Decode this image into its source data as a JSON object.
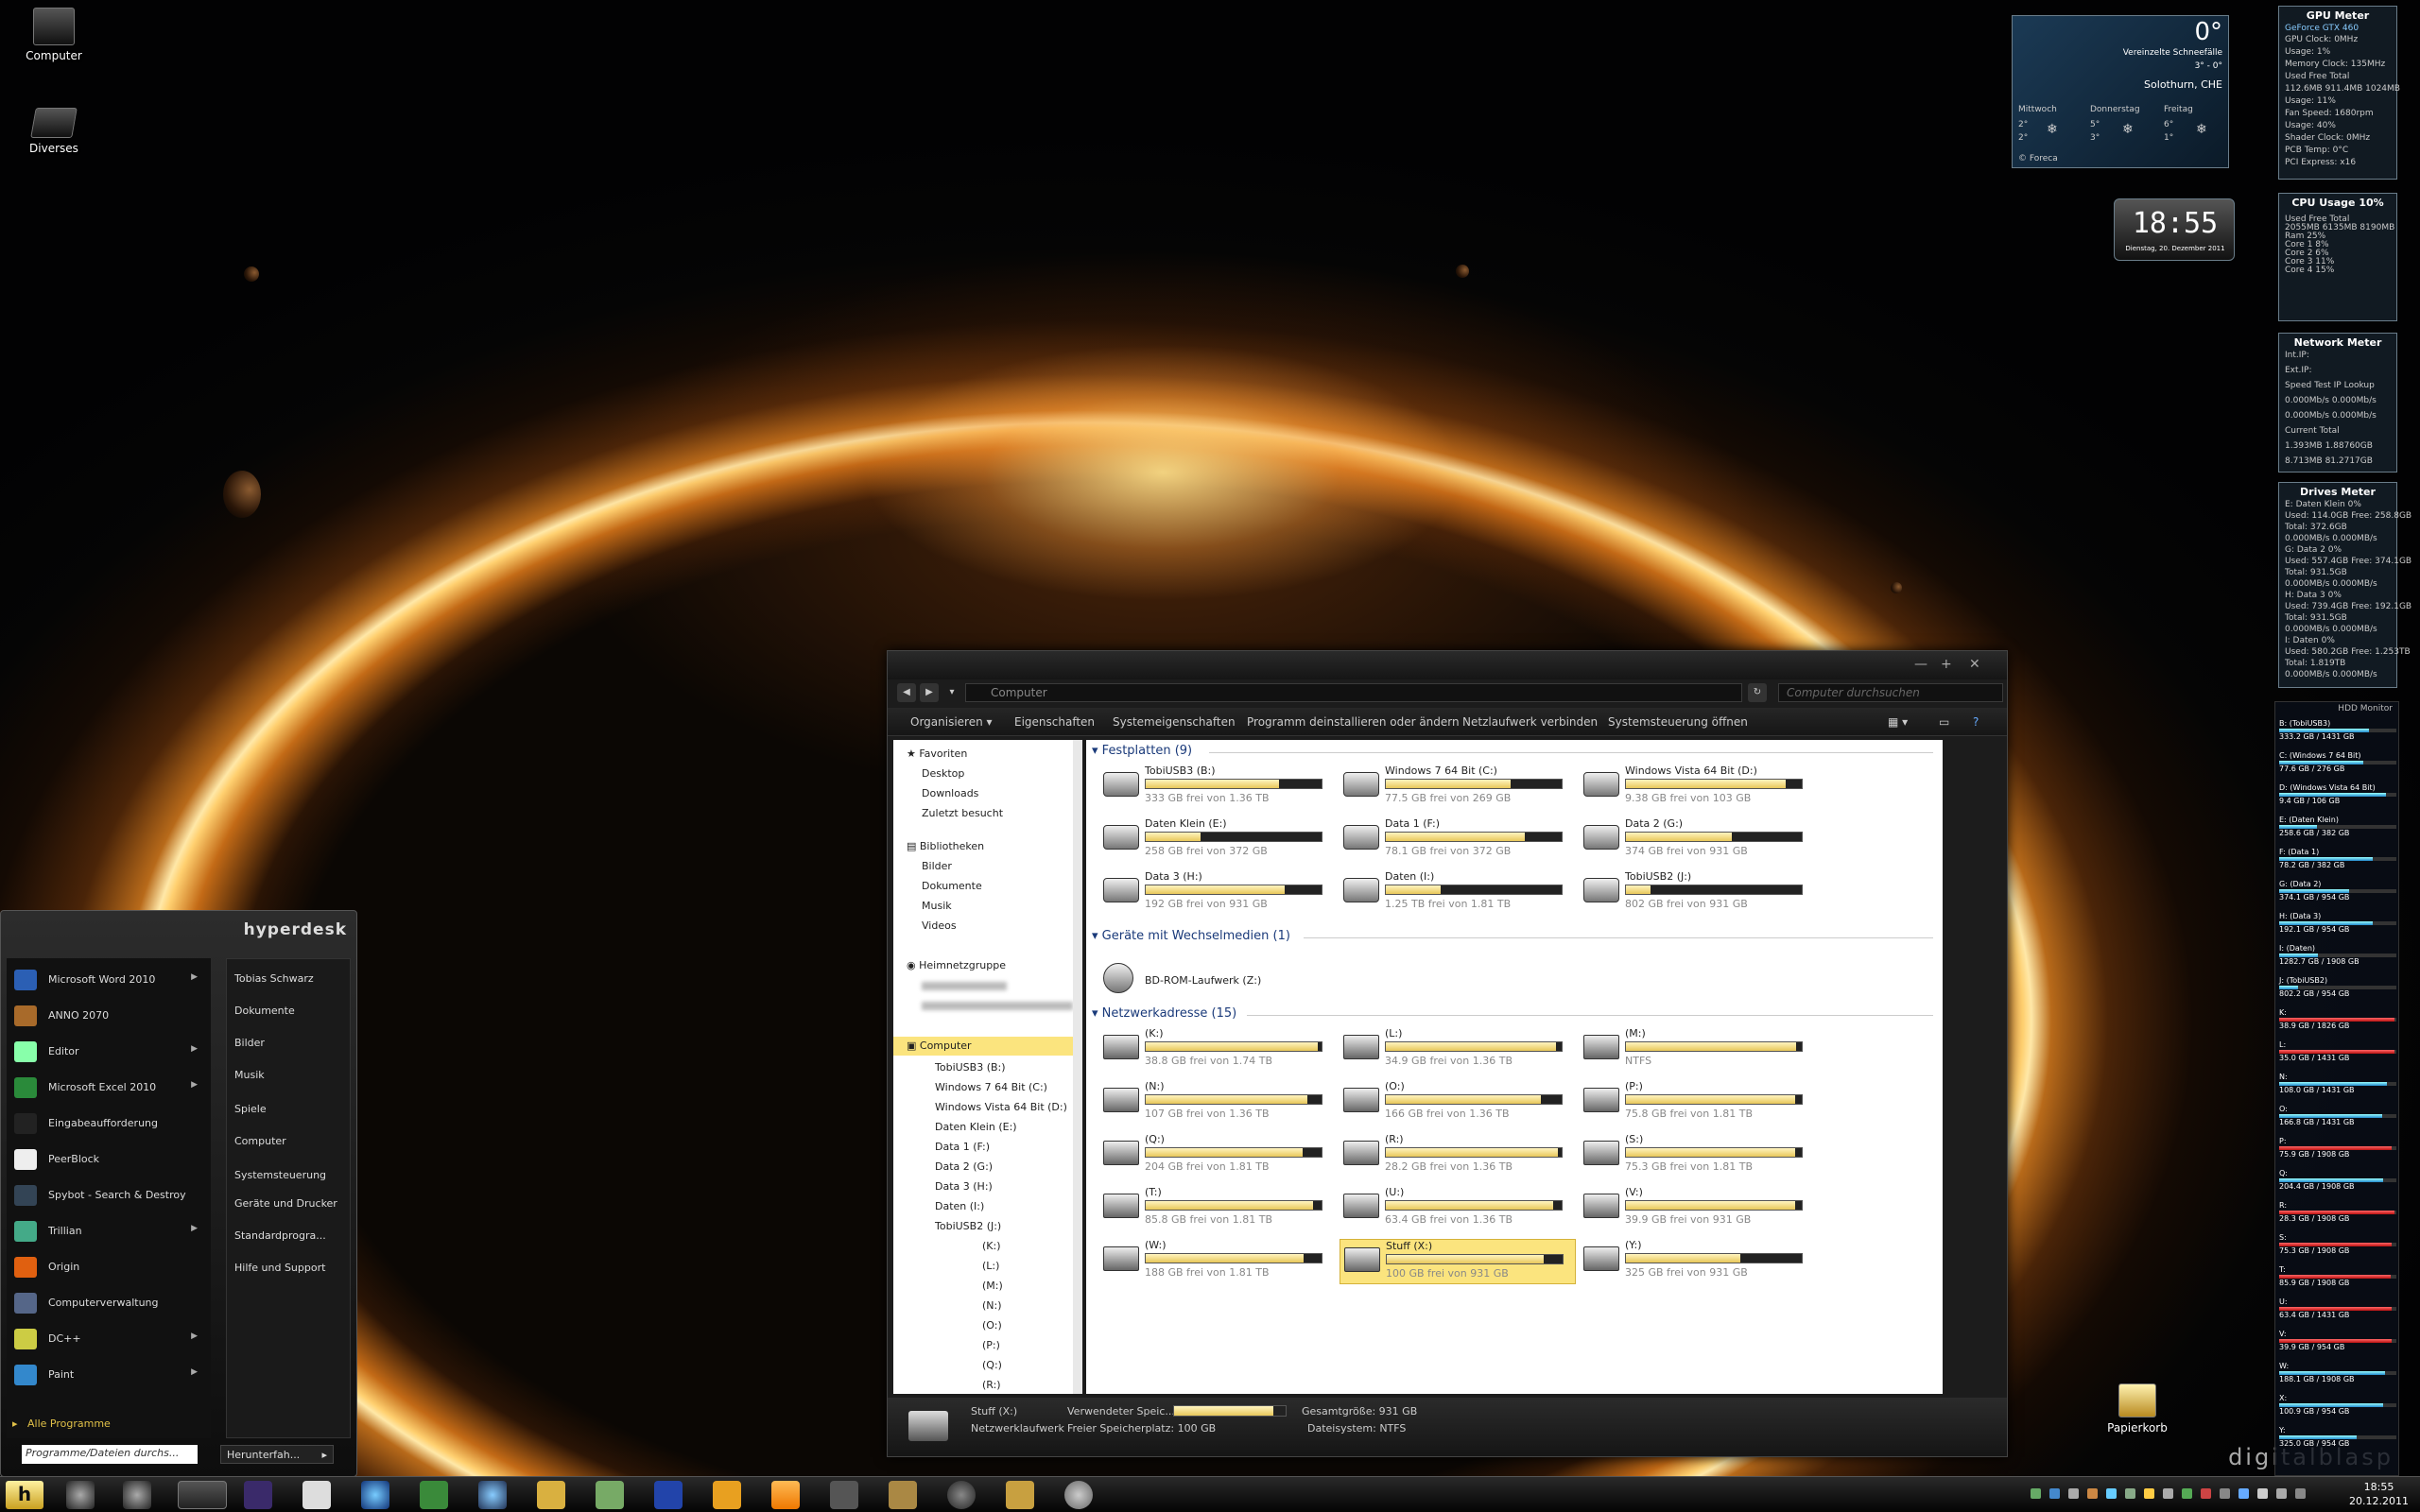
{
  "desktop": {
    "icons": [
      {
        "label": "Computer"
      },
      {
        "label": "Diverses"
      }
    ],
    "recycle_bin": "Papierkorb",
    "watermark": "digitalblasp"
  },
  "explorer": {
    "address": "Computer",
    "search_placeholder": "Computer durchsuchen",
    "toolbar": [
      "Organisieren ▾",
      "Eigenschaften",
      "Systemeigenschaften",
      "Programm deinstallieren oder ändern",
      "Netzlaufwerk verbinden",
      "Systemsteuerung öffnen"
    ],
    "sidebar": {
      "favorites": "Favoriten",
      "favorite_items": [
        "Desktop",
        "Downloads",
        "Zuletzt besucht"
      ],
      "libraries": "Bibliotheken",
      "library_items": [
        "Bilder",
        "Dokumente",
        "Musik",
        "Videos"
      ],
      "homegroup": "Heimnetzgruppe",
      "computer": "Computer",
      "computer_items": [
        "TobiUSB3 (B:)",
        "Windows 7 64 Bit (C:)",
        "Windows Vista 64 Bit (D:)",
        "Daten Klein (E:)",
        "Data 1 (F:)",
        "Data 2 (G:)",
        "Data 3 (H:)",
        "Daten (I:)",
        "TobiUSB2 (J:)"
      ],
      "network_items": [
        "(K:)",
        "(L:)",
        "(M:)",
        "(N:)",
        "(O:)",
        "(P:)",
        "(Q:)",
        "(R:)"
      ]
    },
    "groups": {
      "hard_disks": "Festplatten (9)",
      "removable": "Geräte mit Wechselmedien (1)",
      "network": "Netzwerkadresse (15)"
    },
    "hard_disks": [
      {
        "name": "TobiUSB3 (B:)",
        "free": "333 GB frei von 1.36 TB",
        "used": 0.76
      },
      {
        "name": "Windows 7 64 Bit (C:)",
        "free": "77.5 GB frei von 269 GB",
        "used": 0.71
      },
      {
        "name": "Windows Vista 64 Bit (D:)",
        "free": "9.38 GB frei von 103 GB",
        "used": 0.91
      },
      {
        "name": "Daten Klein (E:)",
        "free": "258 GB frei von 372 GB",
        "used": 0.31
      },
      {
        "name": "Data 1 (F:)",
        "free": "78.1 GB frei von 372 GB",
        "used": 0.79
      },
      {
        "name": "Data 2 (G:)",
        "free": "374 GB frei von 931 GB",
        "used": 0.6
      },
      {
        "name": "Data 3 (H:)",
        "free": "192 GB frei von 931 GB",
        "used": 0.79
      },
      {
        "name": "Daten (I:)",
        "free": "1.25 TB frei von 1.81 TB",
        "used": 0.31
      },
      {
        "name": "TobiUSB2 (J:)",
        "free": "802 GB frei von 931 GB",
        "used": 0.14
      }
    ],
    "removable": [
      {
        "name": "BD-ROM-Laufwerk (Z:)"
      }
    ],
    "network": [
      {
        "name": "(K:)",
        "free": "38.8 GB frei von 1.74 TB",
        "used": 0.98
      },
      {
        "name": "(L:)",
        "free": "34.9 GB frei von 1.36 TB",
        "used": 0.97
      },
      {
        "name": "(M:)",
        "free": "NTFS",
        "used": 0.97
      },
      {
        "name": "(N:)",
        "free": "107 GB frei von 1.36 TB",
        "used": 0.92
      },
      {
        "name": "(O:)",
        "free": "166 GB frei von 1.36 TB",
        "used": 0.88
      },
      {
        "name": "(P:)",
        "free": "75.8 GB frei von 1.81 TB",
        "used": 0.96
      },
      {
        "name": "(Q:)",
        "free": "204 GB frei von 1.81 TB",
        "used": 0.89
      },
      {
        "name": "(R:)",
        "free": "28.2 GB frei von 1.36 TB",
        "used": 0.98
      },
      {
        "name": "(S:)",
        "free": "75.3 GB frei von 1.81 TB",
        "used": 0.96
      },
      {
        "name": "(T:)",
        "free": "85.8 GB frei von 1.81 TB",
        "used": 0.95
      },
      {
        "name": "(U:)",
        "free": "63.4 GB frei von 1.36 TB",
        "used": 0.95
      },
      {
        "name": "(V:)",
        "free": "39.9 GB frei von 931 GB",
        "used": 0.96
      },
      {
        "name": "(W:)",
        "free": "188 GB frei von 1.81 TB",
        "used": 0.9
      },
      {
        "name": "Stuff (X:)",
        "free": "100 GB frei von 931 GB",
        "used": 0.89
      },
      {
        "name": "(Y:)",
        "free": "325 GB frei von 931 GB",
        "used": 0.65
      }
    ],
    "details": {
      "name": "Stuff (X:)",
      "type": "Netzwerklaufwerk",
      "used_label": "Verwendeter Speic...",
      "total_label": "Gesamtgröße: 931 GB",
      "free_label": "Freier Speicherplatz: 100 GB",
      "fs_label": "Dateisystem: NTFS",
      "used": 0.89
    }
  },
  "start_menu": {
    "brand": "hyperdesk",
    "programs": [
      {
        "label": "Microsoft Word 2010",
        "arrow": "▶"
      },
      {
        "label": "ANNO 2070",
        "arrow": ""
      },
      {
        "label": "Editor",
        "arrow": "▶"
      },
      {
        "label": "Microsoft Excel 2010",
        "arrow": "▶"
      },
      {
        "label": "Eingabeaufforderung",
        "arrow": ""
      },
      {
        "label": "PeerBlock",
        "arrow": ""
      },
      {
        "label": "Spybot - Search & Destroy",
        "arrow": ""
      },
      {
        "label": "Trillian",
        "arrow": "▶"
      },
      {
        "label": "Origin",
        "arrow": ""
      },
      {
        "label": "Computerverwaltung",
        "arrow": ""
      },
      {
        "label": "DC++",
        "arrow": "▶"
      },
      {
        "label": "Paint",
        "arrow": "▶"
      }
    ],
    "all_programs": "Alle Programme",
    "right": [
      "Tobias Schwarz",
      "Dokumente",
      "Bilder",
      "Musik",
      "Spiele",
      "Computer",
      "Systemsteuerung",
      "Geräte und Drucker",
      "Standardprogra...",
      "Hilfe und Support"
    ],
    "search_placeholder": "Programme/Dateien durchs...",
    "shutdown": "Herunterfah..."
  },
  "taskbar": {
    "start": "h",
    "time": "18:55",
    "date": "20.12.2011"
  },
  "gadgets": {
    "weather": {
      "temp": "0°",
      "condition": "Vereinzelte Schneefälle",
      "range": "3° - 0°",
      "location": "Solothurn, CHE",
      "days": [
        {
          "day": "Mittwoch",
          "hi": "2°",
          "lo": "2°"
        },
        {
          "day": "Donnerstag",
          "hi": "5°",
          "lo": "3°"
        },
        {
          "day": "Freitag",
          "hi": "6°",
          "lo": "1°"
        }
      ],
      "source": "© Foreca"
    },
    "clock": {
      "time": "18:55",
      "date": "Dienstag, 20. Dezember 2011"
    },
    "gpu": {
      "title": "GPU Meter",
      "model": "GeForce GTX 460",
      "lines": [
        "GPU Clock: 0MHz",
        "Usage: 1%",
        "Memory Clock: 135MHz",
        "Used Free Total",
        "112.6MB 911.4MB 1024MB",
        "Usage: 11%",
        "Fan Speed: 1680rpm",
        "Usage: 40%",
        "Shader Clock: 0MHz",
        "PCB Temp: 0°C",
        "PCI Express: x16"
      ]
    },
    "cpu": {
      "title": "CPU Usage",
      "value": "10%",
      "lines": [
        "Used Free Total",
        "2055MB 6135MB 8190MB",
        "Ram 25%",
        "Core 1 8%",
        "Core 2 6%",
        "Core 3 11%",
        "Core 4 15%"
      ]
    },
    "network": {
      "title": "Network Meter",
      "lines": [
        "Int.IP:",
        "Ext.IP:",
        "Speed Test   IP Lookup",
        "0.000Mb/s  0.000Mb/s",
        "0.000Mb/s  0.000Mb/s",
        "Current        Total",
        "1.393MB     1.88760GB",
        "8.713MB     81.2717GB"
      ]
    },
    "drives": {
      "title": "Drives Meter",
      "lines": [
        "E: Daten Klein 0%",
        "Used: 114.0GB Free: 258.8GB",
        "Total: 372.6GB",
        "0.000MB/s 0.000MB/s",
        "G: Data 2 0%",
        "Used: 557.4GB Free: 374.1GB",
        "Total: 931.5GB",
        "0.000MB/s 0.000MB/s",
        "H: Data 3 0%",
        "Used: 739.4GB Free: 192.1GB",
        "Total: 931.5GB",
        "0.000MB/s 0.000MB/s",
        "I: Daten 0%",
        "Used: 580.2GB Free: 1.253TB",
        "Total: 1.819TB",
        "0.000MB/s 0.000MB/s"
      ]
    },
    "hdd": {
      "title": "HDD Monitor",
      "rows": [
        {
          "n": "B: (TobiUSB3)",
          "s": "333.2 GB / 1431 GB",
          "f": 0.77
        },
        {
          "n": "C: (Windows 7 64 Bit)",
          "s": "77.6 GB / 276 GB",
          "f": 0.72
        },
        {
          "n": "D: (Windows Vista 64 Bit)",
          "s": "9.4 GB / 106 GB",
          "f": 0.91
        },
        {
          "n": "E: (Daten Klein)",
          "s": "258.6 GB / 382 GB",
          "f": 0.32
        },
        {
          "n": "F: (Data 1)",
          "s": "78.2 GB / 382 GB",
          "f": 0.8
        },
        {
          "n": "G: (Data 2)",
          "s": "374.1 GB / 954 GB",
          "f": 0.6
        },
        {
          "n": "H: (Data 3)",
          "s": "192.1 GB / 954 GB",
          "f": 0.8
        },
        {
          "n": "I: (Daten)",
          "s": "1282.7 GB / 1908 GB",
          "f": 0.33
        },
        {
          "n": "J: (TobiUSB2)",
          "s": "802.2 GB / 954 GB",
          "f": 0.16
        },
        {
          "n": "K:",
          "s": "38.9 GB / 1826 GB",
          "f": 0.98
        },
        {
          "n": "L:",
          "s": "35.0 GB / 1431 GB",
          "f": 0.98
        },
        {
          "n": "N:",
          "s": "108.0 GB / 1431 GB",
          "f": 0.92
        },
        {
          "n": "O:",
          "s": "166.8 GB / 1431 GB",
          "f": 0.88
        },
        {
          "n": "P:",
          "s": "75.9 GB / 1908 GB",
          "f": 0.96
        },
        {
          "n": "Q:",
          "s": "204.4 GB / 1908 GB",
          "f": 0.89
        },
        {
          "n": "R:",
          "s": "28.3 GB / 1908 GB",
          "f": 0.98
        },
        {
          "n": "S:",
          "s": "75.3 GB / 1908 GB",
          "f": 0.96
        },
        {
          "n": "T:",
          "s": "85.9 GB / 1908 GB",
          "f": 0.95
        },
        {
          "n": "U:",
          "s": "63.4 GB / 1431 GB",
          "f": 0.96
        },
        {
          "n": "V:",
          "s": "39.9 GB / 954 GB",
          "f": 0.96
        },
        {
          "n": "W:",
          "s": "188.1 GB / 1908 GB",
          "f": 0.9
        },
        {
          "n": "X:",
          "s": "100.9 GB / 954 GB",
          "f": 0.89
        },
        {
          "n": "Y:",
          "s": "325.0 GB / 954 GB",
          "f": 0.66
        }
      ]
    }
  }
}
